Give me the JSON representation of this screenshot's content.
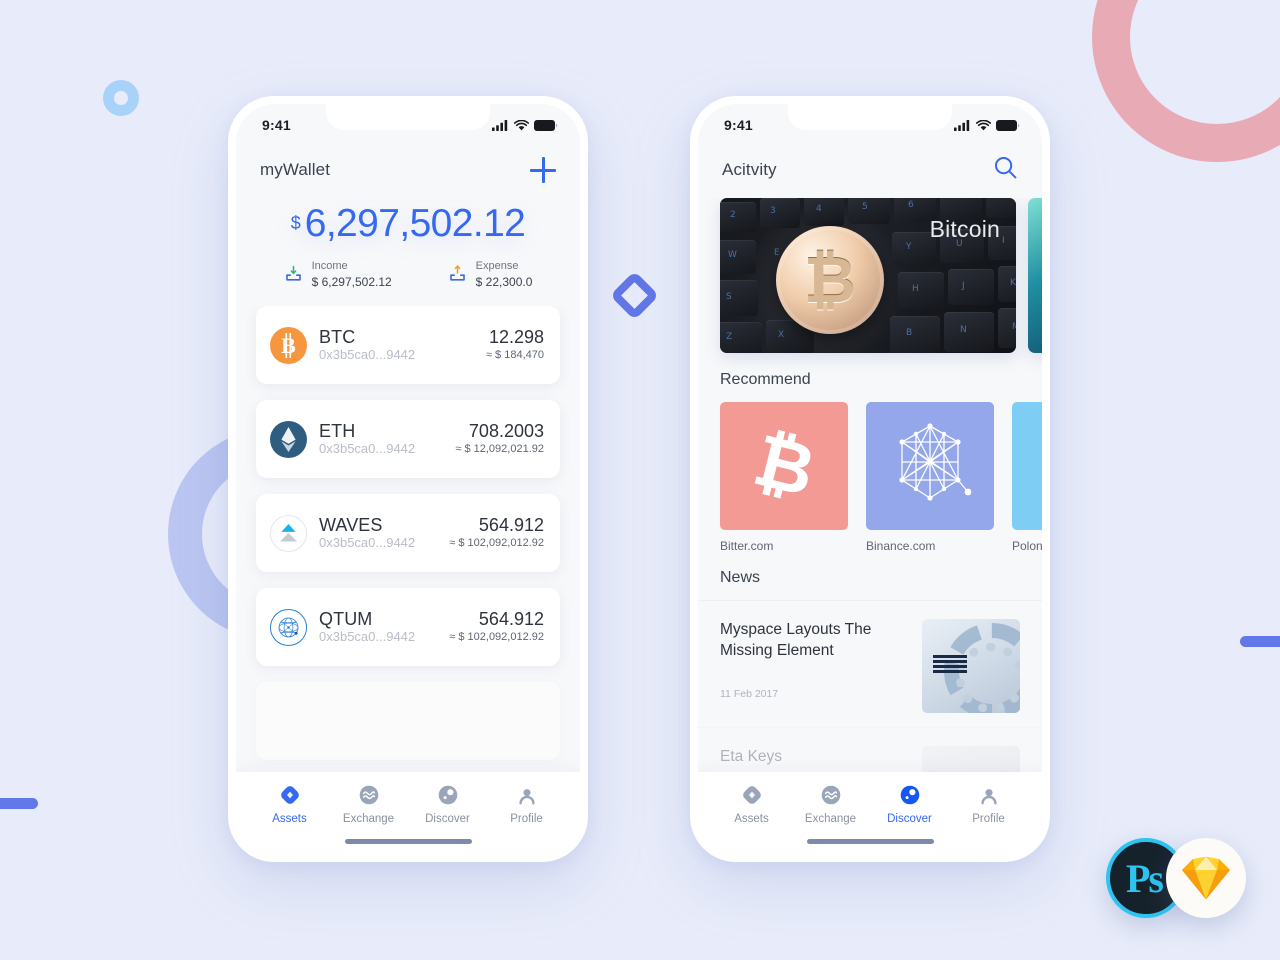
{
  "theme": {
    "background": "#e8ecfa",
    "accent_blue": "#3569f0",
    "deco_pink": "#e8a8b2",
    "deco_lavender": "#b7c2ef",
    "deco_skyblue": "#a8d2f7",
    "deco_bar": "#6277e8"
  },
  "decorations": {
    "ring_pink": "ring-decoration",
    "ring_lavender": "ring-decoration",
    "ring_skyblue": "ring-decoration",
    "diamond": "diamond-outline-decoration",
    "bar_left": "bar-decoration",
    "bar_right": "bar-decoration"
  },
  "wallet_phone": {
    "status": {
      "time": "9:41",
      "signal": "cellular-signal-icon",
      "wifi": "wifi-icon",
      "battery": "battery-icon"
    },
    "header": {
      "title": "myWallet",
      "add_label": "+"
    },
    "balance": {
      "currency_symbol": "$",
      "amount": "6,297,502.12",
      "income": {
        "label": "Income",
        "value": "$ 6,297,502.12",
        "icon": "download-tray-icon"
      },
      "expense": {
        "label": "Expense",
        "value": "$ 22,300.0",
        "icon": "upload-tray-icon"
      }
    },
    "assets": [
      {
        "icon": "bitcoin-icon",
        "symbol": "BTC",
        "address": "0x3b5ca0...9442",
        "amount": "12.298",
        "fiat": "≈ $ 184,470"
      },
      {
        "icon": "ethereum-icon",
        "symbol": "ETH",
        "address": "0x3b5ca0...9442",
        "amount": "708.2003",
        "fiat": "≈ $ 12,092,021.92"
      },
      {
        "icon": "waves-icon",
        "symbol": "WAVES",
        "address": "0x3b5ca0...9442",
        "amount": "564.912",
        "fiat": "≈ $ 102,092,012.92"
      },
      {
        "icon": "qtum-icon",
        "symbol": "QTUM",
        "address": "0x3b5ca0...9442",
        "amount": "564.912",
        "fiat": "≈ $ 102,092,012.92"
      }
    ],
    "tabs": [
      {
        "label": "Assets",
        "icon": "assets-diamond-icon",
        "active": true
      },
      {
        "label": "Exchange",
        "icon": "exchange-waves-icon",
        "active": false
      },
      {
        "label": "Discover",
        "icon": "discover-compass-icon",
        "active": false
      },
      {
        "label": "Profile",
        "icon": "profile-person-icon",
        "active": false
      }
    ]
  },
  "discover_phone": {
    "status": {
      "time": "9:41",
      "signal": "cellular-signal-icon",
      "wifi": "wifi-icon",
      "battery": "battery-icon"
    },
    "header": {
      "title": "Acitvity",
      "search_icon": "search-icon"
    },
    "banners": [
      {
        "caption": "Bitcoin",
        "image": "bitcoin-coin-on-keyboard-photo"
      },
      {
        "caption": "",
        "image": "teal-abstract-photo"
      }
    ],
    "recommend": {
      "title": "Recommend",
      "items": [
        {
          "label": "Bitter.com",
          "icon": "bitcoin-b-icon",
          "color": "#f49a95"
        },
        {
          "label": "Binance.com",
          "icon": "binance-network-icon",
          "color": "#93a7ea"
        },
        {
          "label": "Polonie",
          "icon": "poloniex-icon",
          "color": "#7dcdf5"
        }
      ]
    },
    "news": {
      "title": "News",
      "items": [
        {
          "title": "Myspace Layouts The Missing Element",
          "date": "11 Feb 2017",
          "thumb": "ibm-hardware-photo"
        },
        {
          "title": "Eta Keys",
          "date": "",
          "thumb": "portrait-photo"
        }
      ]
    },
    "tabs": [
      {
        "label": "Assets",
        "icon": "assets-diamond-icon",
        "active": false
      },
      {
        "label": "Exchange",
        "icon": "exchange-waves-icon",
        "active": false
      },
      {
        "label": "Discover",
        "icon": "discover-compass-icon",
        "active": true
      },
      {
        "label": "Profile",
        "icon": "profile-person-icon",
        "active": false
      }
    ]
  },
  "badges": {
    "photoshop": {
      "label": "Ps",
      "name": "photoshop-badge"
    },
    "sketch": {
      "label": "",
      "name": "sketch-badge"
    }
  }
}
